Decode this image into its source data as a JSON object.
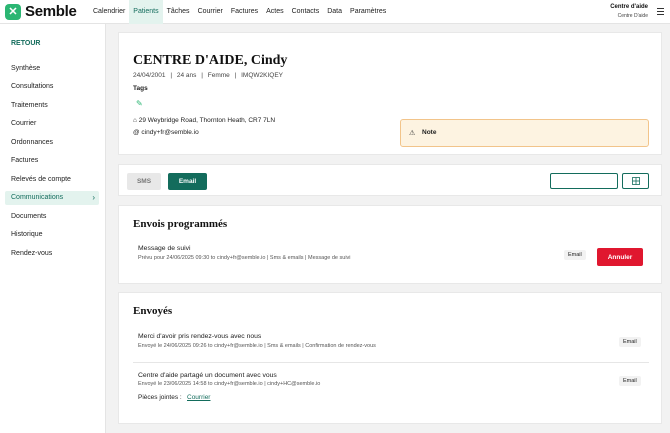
{
  "brand": {
    "name": "Semble",
    "icon": "semble-logo-icon",
    "color": "#2bb673"
  },
  "nav": {
    "items": [
      "Calendrier",
      "Patients",
      "Tâches",
      "Courrier",
      "Factures",
      "Actes",
      "Contacts",
      "Data",
      "Paramètres"
    ],
    "active": "Patients"
  },
  "account": {
    "name": "Centre d'aide",
    "org": "Centre D'aide",
    "menu_icon": "hamburger-menu-icon"
  },
  "sidebar": {
    "back_label": "RETOUR",
    "items": [
      {
        "label": "Synthèse"
      },
      {
        "label": "Consultations"
      },
      {
        "label": "Traitements"
      },
      {
        "label": "Courrier"
      },
      {
        "label": "Ordonnances"
      },
      {
        "label": "Factures"
      },
      {
        "label": "Relevés de compte"
      },
      {
        "label": "Communications",
        "active": true,
        "icon": "chevron-right-icon",
        "glyph": "›"
      },
      {
        "label": "Documents"
      },
      {
        "label": "Historique"
      },
      {
        "label": "Rendez-vous"
      }
    ]
  },
  "patient": {
    "name": "CENTRE D'AIDE, Cindy",
    "dob": "24/04/2001",
    "age": "24 ans",
    "sex": "Femme",
    "id": "IMQW2KIQEY",
    "sep": "|",
    "tags_label": "Tags",
    "edit_icon": "pencil-icon",
    "address": "29 Weybridge Road, Thornton Heath, CR7 7LN",
    "address_icon": "home-icon",
    "email": "cindy+fr@semble.io",
    "email_icon": "at-icon",
    "note_label": "Note",
    "note_icon": "warning-icon"
  },
  "comm_toolbar": {
    "sms_label": "SMS",
    "email_label": "Email",
    "search_value": "",
    "grid_icon": "grid-icon"
  },
  "scheduled": {
    "title": "Envois programmés",
    "items": [
      {
        "title": "Message de suivi",
        "sub": "Prévu pour 24/06/2025 09:30 to cindy+fr@semble.io | Sms & emails | Message de suivi",
        "badge": "Email",
        "action": "Annuler"
      }
    ]
  },
  "sent": {
    "title": "Envoyés",
    "items": [
      {
        "title": "Merci d'avoir pris rendez-vous avec nous",
        "sub": "Envoyé le 24/06/2025 09:26 to cindy+fr@semble.io | Sms & emails | Confirmation de rendez-vous",
        "badge": "Email"
      },
      {
        "title": "Centre d'aide partagé un document avec vous",
        "sub": "Envoyé le 23/06/2025 14:58 to cindy+fr@semble.io | cindy+HC@semble.io",
        "badge": "Email",
        "attach_label": "Pièces jointes :",
        "attach_link": "Courrier"
      }
    ]
  },
  "colors": {
    "accent": "#136c5c",
    "danger": "#e0172f",
    "note_bg": "#fdf3e1"
  }
}
